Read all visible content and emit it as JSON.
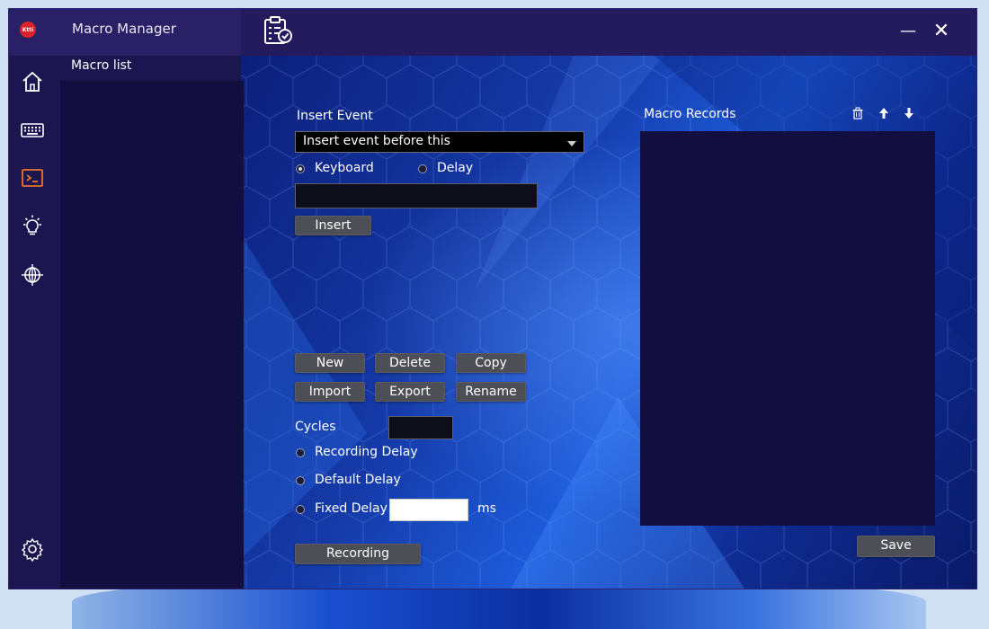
{
  "window": {
    "app_title": "Macro Manager",
    "logo_text": "Ktti",
    "minimize_glyph": "—",
    "close_glyph": "✕"
  },
  "rail": {
    "icons": [
      "home-icon",
      "keyboard-icon",
      "terminal-icon",
      "lightbulb-icon",
      "globe-icon",
      "settings-icon"
    ],
    "active": "terminal-icon",
    "accent": "#e8742a"
  },
  "macro_list": {
    "label": "Macro list"
  },
  "insert_event": {
    "label": "Insert Event",
    "selected_option": "Insert event before this",
    "radio_keyboard": "Keyboard",
    "radio_delay": "Delay",
    "selected_radio": "Keyboard",
    "input_value": "",
    "insert_button": "Insert"
  },
  "actions": {
    "new": "New",
    "delete": "Delete",
    "copy": "Copy",
    "import": "Import",
    "export": "Export",
    "rename": "Rename"
  },
  "cycles": {
    "label": "Cycles",
    "value": ""
  },
  "delay_options": {
    "recording_delay": "Recording Delay",
    "default_delay": "Default Delay",
    "fixed_delay": "Fixed Delay",
    "fixed_delay_value": "",
    "unit": "ms"
  },
  "recording_button": "Recording",
  "records": {
    "label": "Macro Records",
    "save_button": "Save"
  }
}
